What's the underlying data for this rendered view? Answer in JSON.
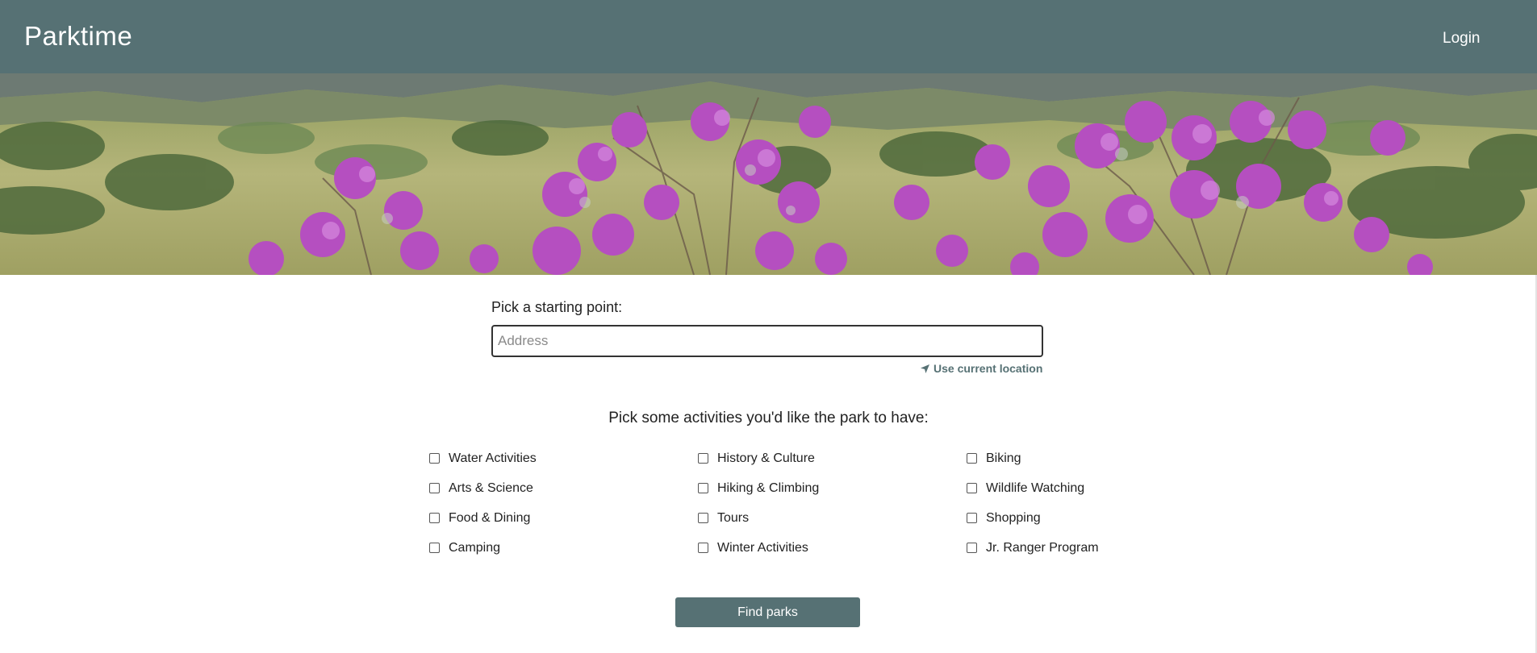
{
  "header": {
    "brand": "Parktime",
    "login_label": "Login",
    "background": "#567174"
  },
  "hero": {
    "image_description_icon": "hero-landscape-image"
  },
  "start": {
    "label": "Pick a starting point:",
    "address_placeholder": "Address",
    "address_value": "",
    "use_location_label": "Use current location"
  },
  "activities": {
    "label": "Pick some activities you'd like the park to have:",
    "columns": [
      [
        {
          "label": "Water Activities",
          "checked": false
        },
        {
          "label": "Arts & Science",
          "checked": false
        },
        {
          "label": "Food & Dining",
          "checked": false
        },
        {
          "label": "Camping",
          "checked": false
        }
      ],
      [
        {
          "label": "History & Culture",
          "checked": false
        },
        {
          "label": "Hiking & Climbing",
          "checked": false
        },
        {
          "label": "Tours",
          "checked": false
        },
        {
          "label": "Winter Activities",
          "checked": false
        }
      ],
      [
        {
          "label": "Biking",
          "checked": false
        },
        {
          "label": "Wildlife Watching",
          "checked": false
        },
        {
          "label": "Shopping",
          "checked": false
        },
        {
          "label": "Jr. Ranger Program",
          "checked": false
        }
      ]
    ]
  },
  "actions": {
    "find_label": "Find parks"
  },
  "colors": {
    "accent": "#567174",
    "text": "#222222",
    "flower": "#b54fc0"
  }
}
